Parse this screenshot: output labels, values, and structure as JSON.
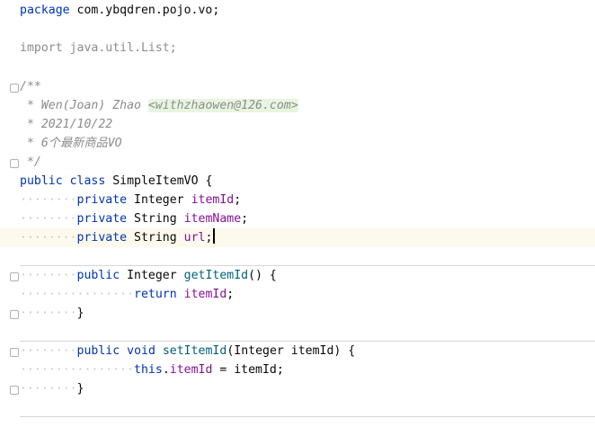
{
  "editor": {
    "package_kw": "package",
    "package_name": " com.ybqdren.pojo.vo;",
    "import_line": "import java.util.List;",
    "doc_open": "/**",
    "doc_author_prefix": " * Wen(Joan) Zhao ",
    "doc_author_email": "<withzhaowen@126.com>",
    "doc_date": " * 2021/10/22",
    "doc_desc": " * 6个最新商品VO",
    "doc_close": " */",
    "class_public": "public",
    "class_kw": "class",
    "class_name": " SimpleItemVO {",
    "indent1": "········",
    "indent2": "················",
    "field1": {
      "modifier": "private",
      "type": " Integer ",
      "name": "itemId",
      "end": ";"
    },
    "field2": {
      "modifier": "private",
      "type": " String ",
      "name": "itemName",
      "end": ";"
    },
    "field3": {
      "modifier": "private",
      "type": " String ",
      "name": "url",
      "end": ";"
    },
    "getter": {
      "public": "public",
      "type": " Integer ",
      "name": "getItemId",
      "sig_end": "() {",
      "return_kw": "return",
      "return_field": "itemId",
      "return_end": ";",
      "close": "}"
    },
    "setter": {
      "public": "public",
      "void": "void",
      "name": "setItemId",
      "params": "(Integer itemId) {",
      "this_kw": "this",
      "dot": ".",
      "field": "itemId",
      "assign": " = itemId;",
      "close": "}"
    },
    "colors": {
      "keyword": "#0033b3",
      "comment": "#8c8c8c",
      "field": "#871094",
      "method": "#00627a",
      "current_line": "#fcfaed"
    }
  }
}
